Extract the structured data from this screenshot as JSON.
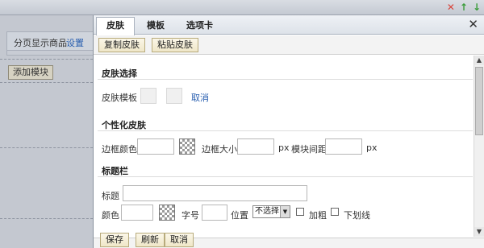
{
  "top_bar": {
    "icons": [
      "close-icon",
      "arrow-up-icon",
      "arrow-down-icon"
    ],
    "close_glyph": "✕",
    "up_glyph": "↑",
    "down_glyph": "↓"
  },
  "background": {
    "module_title": "分页显示商品",
    "module_settings_link": "设置",
    "add_module_button": "添加模块"
  },
  "dialog": {
    "tabs": [
      {
        "label": "皮肤",
        "active": true
      },
      {
        "label": "模板",
        "active": false
      },
      {
        "label": "选项卡",
        "active": false
      }
    ],
    "close_glyph": "✕",
    "toolbar": {
      "copy_skin": "复制皮肤",
      "paste_skin": "粘贴皮肤"
    },
    "skin_select": {
      "title": "皮肤选择",
      "template_label": "皮肤模板",
      "cancel_link": "取消"
    },
    "custom_skin": {
      "title": "个性化皮肤",
      "border_color_label": "边框颜色",
      "border_color_value": "",
      "border_size_label": "边框大小",
      "border_size_value": "",
      "border_size_unit": "px",
      "module_spacing_label": "模块间距",
      "module_spacing_value": "",
      "module_spacing_unit": "px"
    },
    "title_bar": {
      "title": "标题栏",
      "title_label": "标题",
      "title_value": "",
      "color_label": "颜色",
      "color_value": "",
      "font_size_label": "字号",
      "font_size_value": "",
      "position_label": "位置",
      "position_selected": "不选择",
      "bold_label": "加粗",
      "underline_label": "下划线"
    },
    "footer": {
      "save": "保存",
      "refresh": "刷新",
      "cancel": "取消"
    }
  }
}
